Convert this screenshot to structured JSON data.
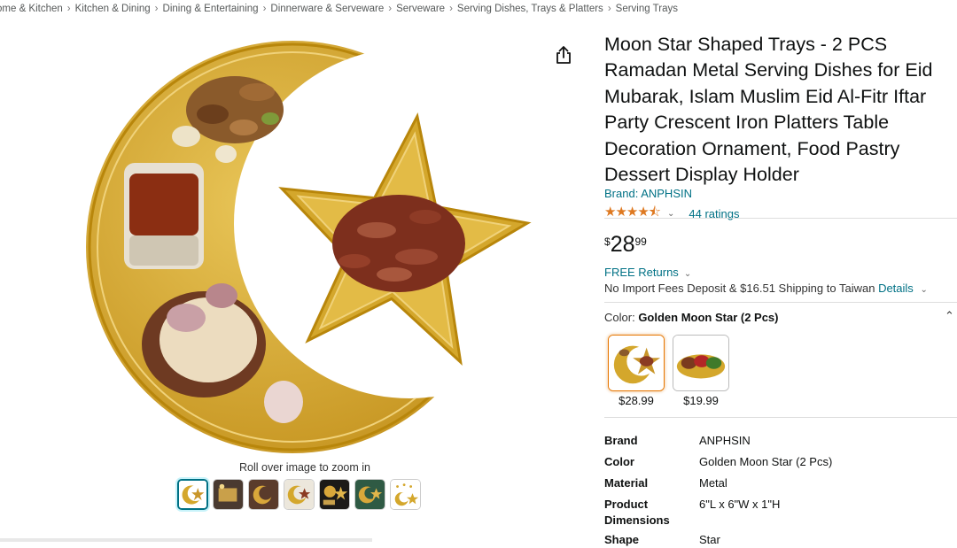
{
  "breadcrumb": {
    "items": [
      "ome & Kitchen",
      "Kitchen & Dining",
      "Dining & Entertaining",
      "Dinnerware & Serveware",
      "Serveware",
      "Serving Dishes, Trays & Platters",
      "Serving Trays"
    ],
    "separator": "›"
  },
  "gallery": {
    "zoom_hint": "Roll over image to zoom in",
    "thumbnail_count": 7,
    "selected_index": 0
  },
  "product": {
    "title": "Moon Star Shaped Trays - 2 PCS Ramadan Metal Serving Dishes for Eid Mubarak, Islam Muslim Eid Al-Fitr Iftar Party Crescent Iron Platters Table Decoration Ornament, Food Pastry Dessert Display Holder",
    "brand_link": "Brand: ANPHSIN",
    "rating_stars": "★★★★⯪",
    "rating_value": 4.5,
    "ratings_count": "44 ratings",
    "price": {
      "currency": "$",
      "whole": "28",
      "fraction": "99"
    },
    "free_returns": "FREE Returns",
    "import_text": "No Import Fees Deposit & $16.51 Shipping to Taiwan",
    "details_link": "Details",
    "color_label": "Color:",
    "color_value": "Golden Moon Star (2 Pcs)",
    "swatches": [
      {
        "price": "$28.99",
        "selected": true
      },
      {
        "price": "$19.99",
        "selected": false
      }
    ]
  },
  "specs": [
    {
      "key": "Brand",
      "value": "ANPHSIN"
    },
    {
      "key": "Color",
      "value": "Golden Moon Star (2 Pcs)"
    },
    {
      "key": "Material",
      "value": "Metal"
    },
    {
      "key": "Product Dimensions",
      "value": "6\"L x 6\"W x 1\"H"
    },
    {
      "key": "Shape",
      "value": "Star"
    }
  ],
  "colors": {
    "link": "#007185",
    "star": "#de7921",
    "gold": "#d4a72c",
    "selected_border": "#e77600"
  }
}
